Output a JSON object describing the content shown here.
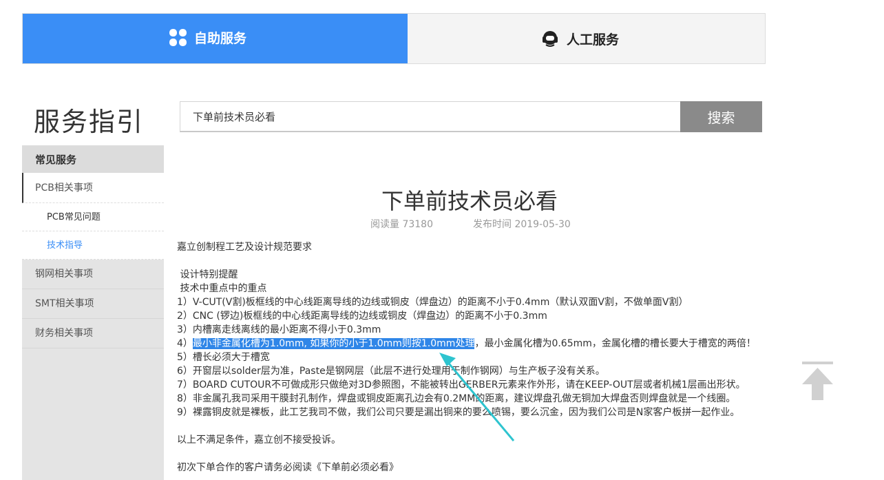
{
  "tabs": {
    "self_service": "自助服务",
    "human_service": "人工服务"
  },
  "page_title": "服务指引",
  "search": {
    "value": "下单前技术员必看",
    "button": "搜索"
  },
  "sidebar": {
    "heading": "常见服务",
    "items": [
      {
        "label": "PCB相关事项"
      },
      {
        "label": "PCB常见问题"
      },
      {
        "label": "技术指导"
      },
      {
        "label": "钢网相关事项"
      },
      {
        "label": "SMT相关事项"
      },
      {
        "label": "财务相关事项"
      }
    ]
  },
  "article": {
    "title": "下单前技术员必看",
    "reads_label": "阅读量 73180",
    "publish_label": "发布时间 2019-05-30",
    "intro": "嘉立创制程工艺及设计规范要求",
    "h1": " 设计特别提醒",
    "h2": " 技术中重点中的重点",
    "l1": "1）V-CUT(V割)板框线的中心线距离导线的边线或铜皮（焊盘边）的距离不小于0.4mm（默认双面V割，不做单面V割）",
    "l2": "2）CNC (锣边)板框线的中心线距离导线的边线或铜皮（焊盘边）的距离不小于0.3mm",
    "l3": "3）内槽离走线离线的最小距离不得小于0.3mm",
    "l4_prefix": "4）",
    "l4_highlight": "最小非金属化槽为1.0mm, 如果你的小于1.0mm则按1.0mm处理",
    "l4_rest": "，最小金属化槽为0.65mm，金属化槽的槽长要大于槽宽的两倍！",
    "l5": "5）槽长必须大于槽宽",
    "l6": "6）开窗层以solder层为准，Paste是钢网层（此层不进行处理用于制作钢网）与生产板子没有关系。",
    "l7": "7）BOARD CUTOUR不可做成形只做绝对3D参照图，不能被转出GERBER元素来作外形，请在KEEP-OUT层或者机械1层画出形状。",
    "l8": "8）非金属孔我司采用干膜封孔制作，焊盘或铜皮距离孔边会有0.2MM的距离，建议焊盘孔做无铜加大焊盘否则焊盘就是一个线圈。",
    "l9": "9）裸露铜皮就是裸板，此工艺我司不做，我们公司只要是漏出铜来的要么喷锡，要么沉金，因为我们公司是N家客户板拼一起作业。",
    "footer1": "以上不满足条件，嘉立创不接受投诉。",
    "footer2": "初次下单合作的客户请务必阅读《下单前必须必看》"
  },
  "colors": {
    "accent": "#3a8ef6",
    "highlight": "#2f86e8",
    "annotation_arrow": "#2ec4cf",
    "search_button": "#8a8a8a"
  }
}
